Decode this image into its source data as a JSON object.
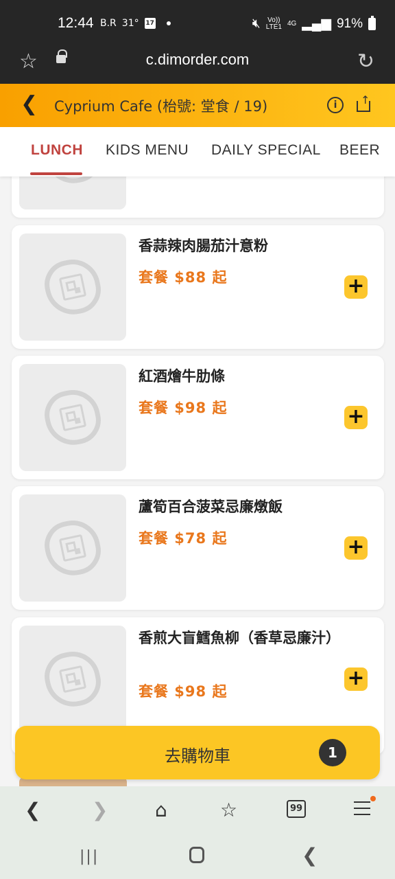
{
  "status_bar": {
    "time": "12:44",
    "icons_left": [
      "B.R",
      "31°"
    ],
    "calendar_day": "17",
    "network_top": "Vo))",
    "network_bottom": "LTE1",
    "network_4g": "4G",
    "battery": "91%"
  },
  "browser": {
    "url": "c.dimorder.com",
    "tabs_count": "99"
  },
  "header": {
    "title": "Cyprium Cafe (枱號: 堂食 / 19)"
  },
  "tabs": [
    "LUNCH",
    "KIDS MENU",
    "DAILY SPECIAL",
    "BEER"
  ],
  "menu_items": [
    {
      "name": "香蒜辣肉腸茄汁意粉",
      "price": "套餐  $88  起"
    },
    {
      "name": "紅酒燴牛肋條",
      "price": "套餐  $98  起"
    },
    {
      "name": "蘆筍百合菠菜忌廉燉飯",
      "price": "套餐  $78  起"
    },
    {
      "name": "香煎大盲鱈魚柳（香草忌廉汁）",
      "price": "套餐  $98  起"
    }
  ],
  "cart": {
    "label": "去購物車",
    "count": "1"
  }
}
